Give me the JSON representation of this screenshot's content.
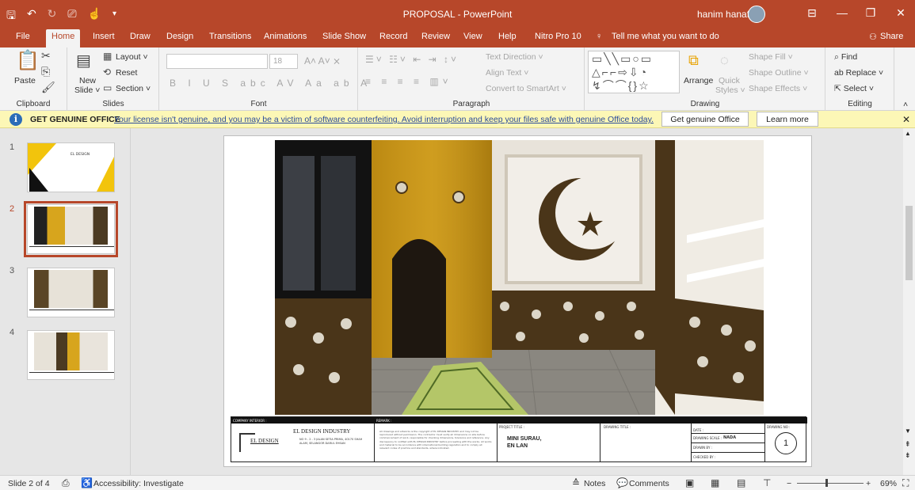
{
  "titlebar": {
    "document_title": "PROPOSAL - PowerPoint",
    "user_name": "hanim hanaffi"
  },
  "tabs": [
    "File",
    "Home",
    "Insert",
    "Draw",
    "Design",
    "Transitions",
    "Animations",
    "Slide Show",
    "Record",
    "Review",
    "View",
    "Help",
    "Nitro Pro 10"
  ],
  "tell_me": "Tell me what you want to do",
  "share": "Share",
  "ribbon": {
    "clipboard": {
      "label": "Clipboard",
      "paste": "Paste"
    },
    "slides": {
      "label": "Slides",
      "new_slide": "New",
      "new_slide2": "Slide ˅",
      "layout": "Layout ˅",
      "reset": "Reset",
      "section": "Section ˅"
    },
    "font": {
      "label": "Font",
      "size": "18"
    },
    "paragraph": {
      "label": "Paragraph",
      "text_direction": "Text Direction ˅",
      "align_text": "Align Text ˅",
      "convert_smartart": "Convert to SmartArt ˅"
    },
    "drawing": {
      "label": "Drawing",
      "arrange": "Arrange",
      "quick_styles": "Quick",
      "quick_styles2": "Styles ˅",
      "shape_fill": "Shape Fill ˅",
      "shape_outline": "Shape Outline ˅",
      "shape_effects": "Shape Effects ˅"
    },
    "editing": {
      "label": "Editing",
      "find": "Find",
      "replace": "Replace ˅",
      "select": "Select ˅"
    }
  },
  "message_bar": {
    "title": "GET GENUINE OFFICE",
    "text": "Your license isn't genuine, and you may be a victim of software counterfeiting. Avoid interruption and keep your files safe with genuine Office today.",
    "button_primary": "Get genuine Office",
    "button_secondary": "Learn more"
  },
  "thumbnails": [
    {
      "number": "1",
      "title": "EL DESIGN"
    },
    {
      "number": "2"
    },
    {
      "number": "3"
    },
    {
      "number": "4"
    }
  ],
  "slide": {
    "company_label": "COMPANY INTERIOR :",
    "company_name": "EL DESIGN INDUSTRY",
    "company_logo": "EL DESIGN",
    "address": "NO 9 - 2 - 3 JALAN SETIA PRIMA, 40170 SHAH ALAM, SELANGOR DARUL EHSAN",
    "remark_label": "REMARK :",
    "remark_text": "All drawings and artworks is the copyright of EL DESIGN INDUSTRY and may not be reproduced without permission. The contractor must verify all dimensions on site before commencement of work, responsible for checking dimensions, tolerance and reference. Any discrepancy to notified with EL DESIGN INDUSTRY before proceeding with the works. All works and material to be accordance with international building regulation and to comply all relevant codes of practice and standards, where indicated.",
    "project_label": "PROJECT TITLE :",
    "project_title": "MINI SURAU,",
    "project_title2": "EN LAN",
    "drawing_title_label": "DRAWING TITLE :",
    "date_label": "DATE :",
    "drawing_scale_label": "DRAWING SCALE :",
    "drawing_scale_value": "NADA",
    "drawn_by_label": "DRAWN BY :",
    "checked_by_label": "CHECKED BY :",
    "drawing_no_label": "DRAWING NO :",
    "drawing_no": "1"
  },
  "statusbar": {
    "slide_info": "Slide 2 of 4",
    "accessibility": "Accessibility: Investigate",
    "notes": "Notes",
    "comments": "Comments",
    "zoom": "69%"
  },
  "colors": {
    "accent": "#b7472a",
    "message_bar": "#fcf7b6",
    "link": "#2b4c9b"
  }
}
